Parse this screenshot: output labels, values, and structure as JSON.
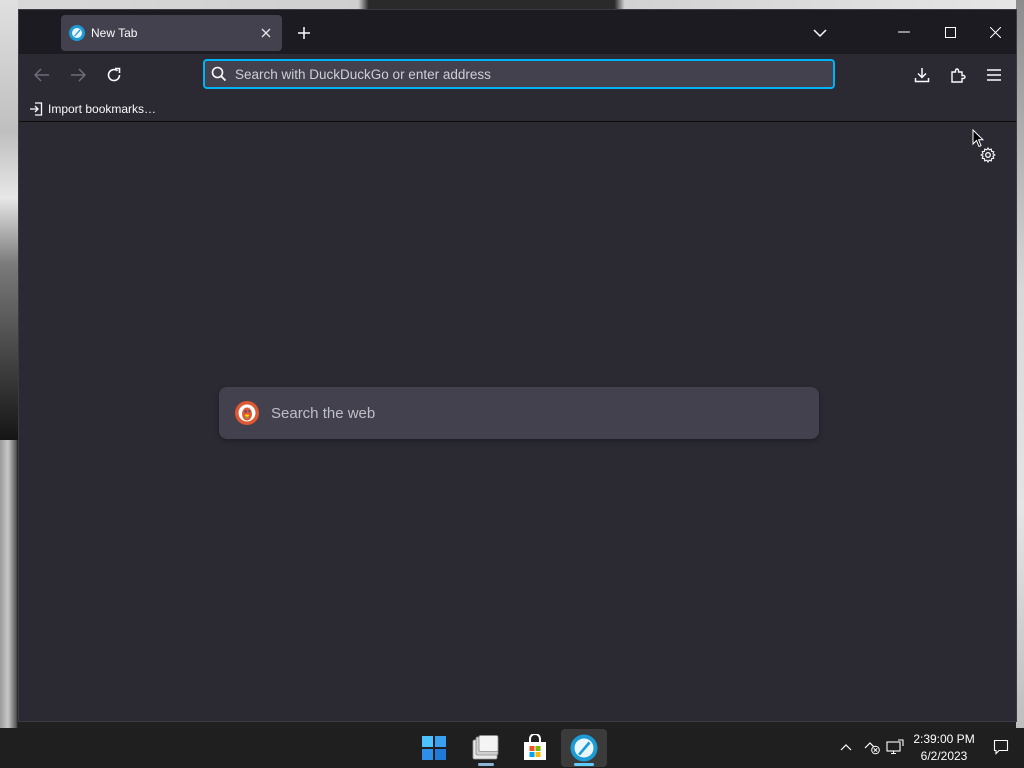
{
  "tab": {
    "title": "New Tab",
    "favicon": "firefox-icon",
    "close_icon": "close-icon"
  },
  "titlebar": {
    "new_tab_icon": "plus-icon",
    "list_tabs_icon": "chevron-down-icon",
    "minimize_icon": "minimize-icon",
    "maximize_icon": "maximize-icon",
    "close_icon": "close-icon"
  },
  "toolbar": {
    "back_icon": "arrow-left-icon",
    "forward_icon": "arrow-right-icon",
    "reload_icon": "reload-icon",
    "downloads_icon": "download-icon",
    "extensions_icon": "puzzle-icon",
    "menu_icon": "hamburger-menu-icon"
  },
  "urlbar": {
    "placeholder": "Search with DuckDuckGo or enter address",
    "value": "",
    "icon": "search-icon"
  },
  "bookmarks": {
    "import_label": "Import bookmarks…",
    "import_icon": "import-icon"
  },
  "newtab": {
    "search_placeholder": "Search the web",
    "search_engine_icon": "duckduckgo-icon",
    "settings_icon": "gear-icon"
  },
  "taskbar": {
    "apps": [
      {
        "name": "Start",
        "icon": "windows-start-icon"
      },
      {
        "name": "File Explorer",
        "icon": "file-explorer-icon"
      },
      {
        "name": "Microsoft Store",
        "icon": "store-icon"
      },
      {
        "name": "Firefox",
        "icon": "firefox-icon"
      }
    ],
    "tray": {
      "chevron_icon": "chevron-up-icon",
      "network_icon": "network-disconnected-icon",
      "display_icon": "display-icon",
      "time": "2:39:00 PM",
      "date": "6/2/2023",
      "notifications_icon": "notification-icon"
    }
  },
  "colors": {
    "chrome_dark": "#1c1b22",
    "toolbar": "#2b2a33",
    "field": "#42414d",
    "focus_accent": "#00b3f4",
    "taskbar": "#1f1f1f"
  }
}
